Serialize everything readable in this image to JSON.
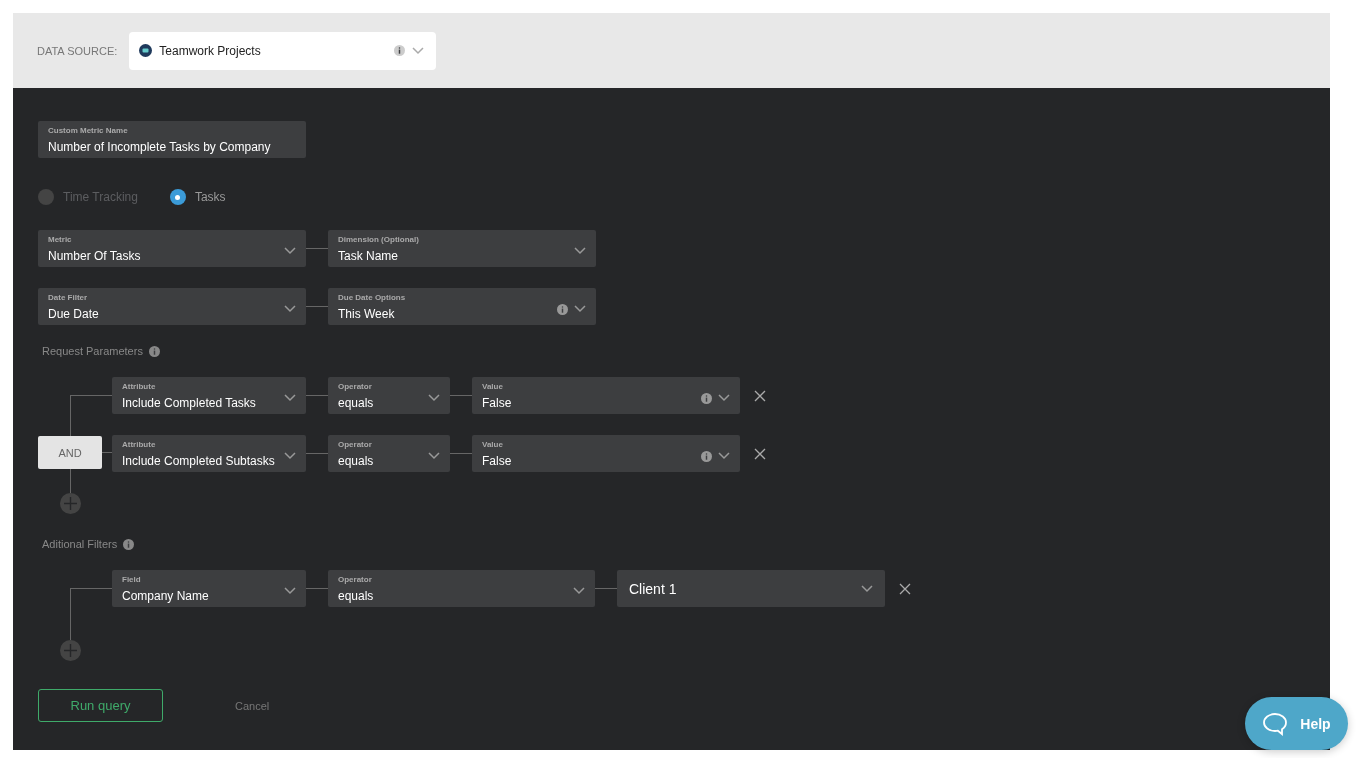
{
  "data_source": {
    "label": "DATA SOURCE:",
    "value": "Teamwork Projects",
    "has_info": true
  },
  "metric_name": {
    "label": "Custom Metric Name",
    "value": "Number of Incomplete Tasks by Company"
  },
  "metric_types": [
    {
      "label": "Time Tracking",
      "selected": false
    },
    {
      "label": "Tasks",
      "selected": true
    }
  ],
  "selector_rows": [
    [
      {
        "label": "Metric",
        "value": "Number Of Tasks",
        "has_info": false
      },
      {
        "label": "Dimension (Optional)",
        "value": "Task Name",
        "has_info": false
      }
    ],
    [
      {
        "label": "Date Filter",
        "value": "Due Date",
        "has_info": false
      },
      {
        "label": "Due Date Options",
        "value": "This Week",
        "has_info": true
      }
    ]
  ],
  "request_parameters": {
    "title": "Request Parameters",
    "conjunction": "AND",
    "rows": [
      [
        {
          "label": "Attribute",
          "value": "Include Completed Tasks",
          "has_info": false
        },
        {
          "label": "Operator",
          "value": "equals",
          "has_info": false
        },
        {
          "label": "Value",
          "value": "False",
          "has_info": true
        }
      ],
      [
        {
          "label": "Attribute",
          "value": "Include Completed Subtasks",
          "has_info": false
        },
        {
          "label": "Operator",
          "value": "equals",
          "has_info": false
        },
        {
          "label": "Value",
          "value": "False",
          "has_info": true
        }
      ]
    ]
  },
  "additional_filters": {
    "title": "Aditional Filters",
    "rows": [
      [
        {
          "label": "Field",
          "value": "Company Name",
          "has_info": false
        },
        {
          "label": "Operator",
          "value": "equals",
          "has_info": false
        },
        {
          "value": "Client 1",
          "has_info": false
        }
      ]
    ]
  },
  "actions": {
    "primary": "Run query",
    "secondary": "Cancel"
  },
  "help": {
    "label": "Help"
  }
}
